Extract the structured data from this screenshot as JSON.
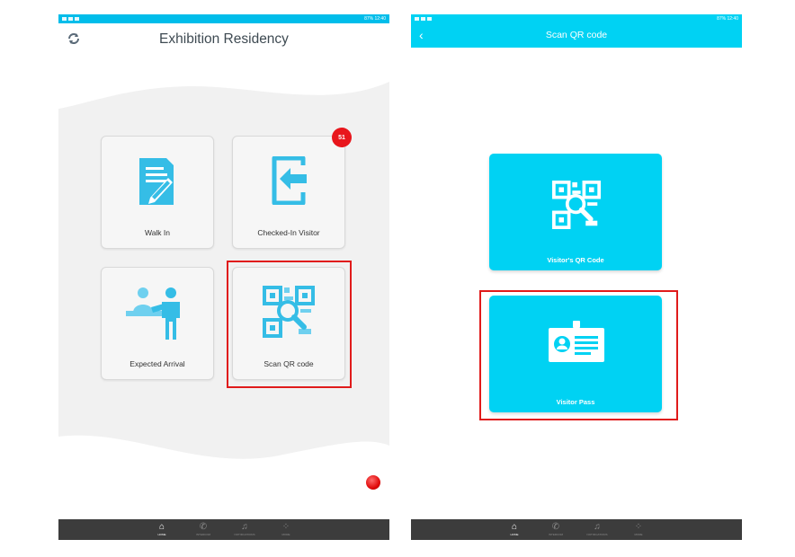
{
  "left": {
    "title": "Exhibition Residency",
    "tiles": [
      {
        "label": "Walk In"
      },
      {
        "label": "Checked-In Visitor",
        "badge": "51"
      },
      {
        "label": "Expected Arrival"
      },
      {
        "label": "Scan QR code"
      }
    ],
    "nav": [
      {
        "icon": "home-icon",
        "label": "HOME",
        "active": true
      },
      {
        "icon": "phone-icon",
        "label": "INTERCOM"
      },
      {
        "icon": "bell-icon",
        "label": "NOTIFICATIONS"
      },
      {
        "icon": "grid-icon",
        "label": "MORE"
      }
    ],
    "status": {
      "time": "12:40",
      "battery": "87%"
    }
  },
  "right": {
    "title": "Scan QR code",
    "cards": [
      {
        "label": "Visitor's QR Code"
      },
      {
        "label": "Visitor Pass"
      }
    ],
    "nav": [
      {
        "icon": "home-icon",
        "label": "HOME",
        "active": true
      },
      {
        "icon": "phone-icon",
        "label": "INTERCOM"
      },
      {
        "icon": "bell-icon",
        "label": "NOTIFICATIONS"
      },
      {
        "icon": "grid-icon",
        "label": "MORE"
      }
    ],
    "status": {
      "time": "12:40",
      "battery": "87%"
    }
  },
  "colors": {
    "accent": "#00d2f3",
    "tile_icon": "#1fb6e0",
    "badge": "#e8161c",
    "highlight_box": "#e01b1b"
  }
}
